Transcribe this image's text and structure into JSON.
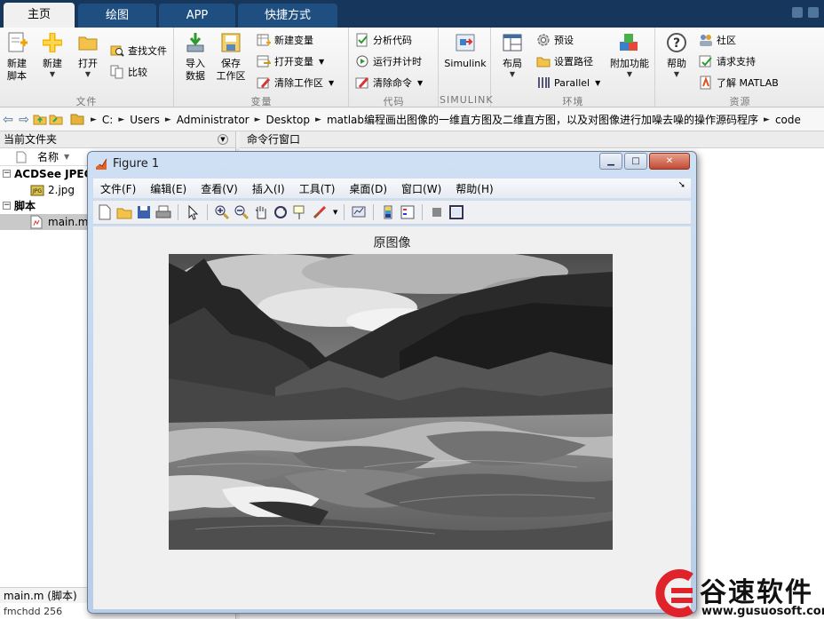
{
  "tabs": [
    {
      "label": "主页",
      "active": true
    },
    {
      "label": "绘图",
      "active": false
    },
    {
      "label": "APP",
      "active": false
    },
    {
      "label": "快捷方式",
      "active": false
    }
  ],
  "ribbon": {
    "file": {
      "label": "文件",
      "new_script": "新建\n脚本",
      "new": "新建",
      "open": "打开",
      "find_files": "查找文件",
      "compare": "比较"
    },
    "variable": {
      "label": "变量",
      "import_data": "导入\n数据",
      "save_workspace": "保存\n工作区",
      "new_variable": "新建变量",
      "open_variable": "打开变量",
      "clear_workspace": "清除工作区"
    },
    "code": {
      "label": "代码",
      "analyze_code": "分析代码",
      "run_and_time": "运行并计时",
      "clear_commands": "清除命令"
    },
    "simulink": {
      "label": "SIMULINK",
      "simulink": "Simulink"
    },
    "environment": {
      "label": "环境",
      "layout": "布局",
      "preferences": "预设",
      "set_path": "设置路径",
      "parallel": "Parallel",
      "add_ons": "附加功能"
    },
    "resources": {
      "label": "资源",
      "help": "帮助",
      "community": "社区",
      "request_support": "请求支持",
      "learn_matlab": "了解 MATLAB"
    }
  },
  "address": {
    "crumbs": [
      "C:",
      "Users",
      "Administrator",
      "Desktop",
      "matlab编程画出图像的一维直方图及二维直方图，以及对图像进行加噪去噪的操作源码程序",
      "code"
    ]
  },
  "current_folder": {
    "title": "当前文件夹",
    "column_name": "名称",
    "groups": [
      {
        "label": "ACDSee JPEG",
        "files": [
          "2.jpg"
        ]
      },
      {
        "label": "脚本",
        "files": [
          "main.m"
        ]
      }
    ],
    "status": "main.m  (脚本)",
    "bottom_text": "fmchdd 256"
  },
  "command_window": {
    "title": "命令行窗口"
  },
  "figure": {
    "title": "Figure 1",
    "menus": [
      "文件(F)",
      "编辑(E)",
      "查看(V)",
      "插入(I)",
      "工具(T)",
      "桌面(D)",
      "窗口(W)",
      "帮助(H)"
    ],
    "axes_title": "原图像"
  },
  "watermark": {
    "name": "谷速软件",
    "url": "www.gusuosoft.com"
  },
  "colors": {
    "tabbar": "#16375b",
    "tab": "#1f4f80",
    "logo_red": "#e0222a",
    "titlebar": "#cfe0f4"
  }
}
